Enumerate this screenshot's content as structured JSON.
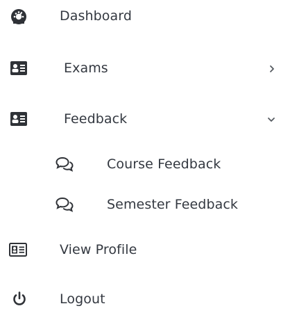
{
  "menu": {
    "items": [
      {
        "label": "Dashboard",
        "icon": "dashboard-icon"
      },
      {
        "label": "Exams",
        "icon": "id-card-icon",
        "expandable": true,
        "expanded": false
      },
      {
        "label": "Feedback",
        "icon": "id-card-icon",
        "expandable": true,
        "expanded": true,
        "children": [
          {
            "label": "Course Feedback",
            "icon": "chat-bubbles-icon"
          },
          {
            "label": "Semester Feedback",
            "icon": "chat-bubbles-icon"
          }
        ]
      },
      {
        "label": "View Profile",
        "icon": "profile-card-icon"
      },
      {
        "label": "Logout",
        "icon": "power-icon"
      }
    ]
  },
  "colors": {
    "text": "#333840",
    "icon": "#2f3237",
    "background": "#ffffff"
  }
}
